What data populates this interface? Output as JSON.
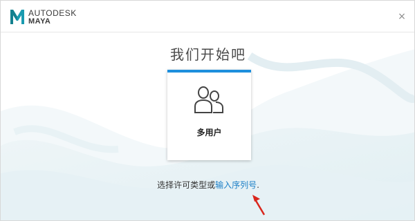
{
  "titlebar": {
    "brand": "AUTODESK",
    "product": "MAYA",
    "close_symbol": "×"
  },
  "main": {
    "title": "我们开始吧",
    "card": {
      "label": "多用户",
      "icon": "users-icon",
      "accent_color": "#1d8fdd"
    },
    "license_text": "选择许可类型或",
    "license_link": "输入序列号",
    "license_suffix": "."
  },
  "annotation": {
    "arrow_color": "#d9261c"
  }
}
